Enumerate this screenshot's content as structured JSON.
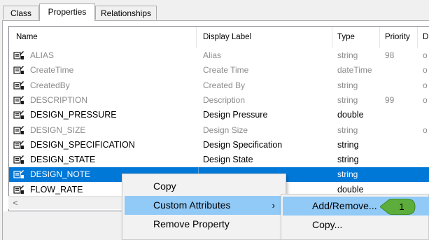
{
  "tabs": [
    "Class",
    "Properties",
    "Relationships"
  ],
  "active_tab": "Properties",
  "columns": [
    "Name",
    "Display Label",
    "Type",
    "Priority",
    "D"
  ],
  "rows": [
    {
      "name": "ALIAS",
      "label": "Alias",
      "type": "string",
      "priority": "98",
      "d": "o",
      "style": "gray"
    },
    {
      "name": "CreateTime",
      "label": "Create Time",
      "type": "dateTime",
      "priority": "",
      "d": "o",
      "style": "gray"
    },
    {
      "name": "CreatedBy",
      "label": "Created By",
      "type": "string",
      "priority": "",
      "d": "o",
      "style": "gray"
    },
    {
      "name": "DESCRIPTION",
      "label": "Description",
      "type": "string",
      "priority": "99",
      "d": "o",
      "style": "gray"
    },
    {
      "name": "DESIGN_PRESSURE",
      "label": "Design Pressure",
      "type": "double",
      "priority": "",
      "d": "",
      "style": "bold"
    },
    {
      "name": "DESIGN_SIZE",
      "label": "Design Size",
      "type": "string",
      "priority": "",
      "d": "o",
      "style": "gray"
    },
    {
      "name": "DESIGN_SPECIFICATION",
      "label": "Design Specification",
      "type": "string",
      "priority": "",
      "d": "",
      "style": "bold"
    },
    {
      "name": "DESIGN_STATE",
      "label": "Design State",
      "type": "string",
      "priority": "",
      "d": "",
      "style": "bold"
    },
    {
      "name": "DESIGN_NOTE",
      "label": "",
      "type": "string",
      "priority": "",
      "d": "",
      "style": "selected"
    },
    {
      "name": "FLOW_RATE",
      "label": "",
      "type": "double",
      "priority": "",
      "d": "",
      "style": "bold"
    }
  ],
  "context_menu": {
    "items": [
      {
        "label": "Copy",
        "has_submenu": false,
        "highlighted": false
      },
      {
        "label": "Custom Attributes",
        "has_submenu": true,
        "highlighted": true
      },
      {
        "label": "Remove Property",
        "has_submenu": false,
        "highlighted": false
      }
    ],
    "submenu_arrow": "›"
  },
  "submenu": {
    "items": [
      {
        "label": "Add/Remove...",
        "highlighted": true
      },
      {
        "label": "Copy...",
        "highlighted": false
      }
    ]
  },
  "callout": {
    "number": "1",
    "color": "#5cad3c"
  },
  "scroll_left_arrow": "<",
  "colors": {
    "selection": "#0078d7",
    "menu_highlight": "#91c9f7",
    "gray_text": "#8c8c8c"
  }
}
